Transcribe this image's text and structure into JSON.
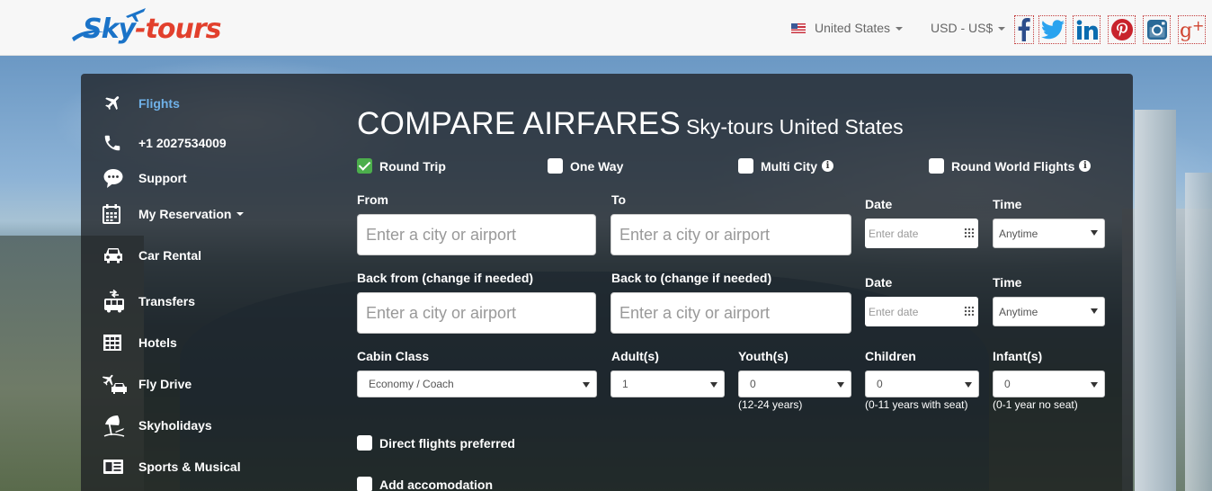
{
  "header": {
    "logo_text_sky": "Sky",
    "logo_text_tours": "-tours",
    "country": "United States",
    "currency": "USD - US$",
    "social": [
      "facebook-icon",
      "twitter-icon",
      "linkedin-icon",
      "pinterest-icon",
      "instagram-icon",
      "google-plus-icon"
    ]
  },
  "sidebar": {
    "items": [
      {
        "label": "Flights",
        "icon": "plane-icon",
        "active": true
      },
      {
        "label": "+1 2027534009",
        "icon": "phone-icon"
      },
      {
        "label": "Support",
        "icon": "chat-icon"
      },
      {
        "label": "My Reservation",
        "icon": "calendar-icon",
        "dropdown": true
      },
      {
        "label": "Car Rental",
        "icon": "car-icon"
      },
      {
        "label": "Transfers",
        "icon": "bus-icon"
      },
      {
        "label": "Hotels",
        "icon": "hotel-icon"
      },
      {
        "label": "Fly Drive",
        "icon": "fly-drive-icon"
      },
      {
        "label": "Skyholidays",
        "icon": "beach-umbrella-icon"
      },
      {
        "label": "Sports & Musical",
        "icon": "ticket-icon"
      }
    ]
  },
  "form": {
    "title": "COMPARE AIRFARES",
    "subtitle": "Sky-tours United States",
    "trip_types": [
      {
        "label": "Round Trip",
        "checked": true
      },
      {
        "label": "One Way",
        "checked": false
      },
      {
        "label": "Multi City",
        "checked": false,
        "info": true
      },
      {
        "label": "Round World Flights",
        "checked": false,
        "info": true
      }
    ],
    "outbound": {
      "from_label": "From",
      "to_label": "To",
      "date_label": "Date",
      "time_label": "Time",
      "from_placeholder": "Enter a city or airport",
      "to_placeholder": "Enter a city or airport",
      "date_placeholder": "Enter date",
      "time_value": "Anytime"
    },
    "return": {
      "from_label": "Back from (change if needed)",
      "to_label": "Back to (change if needed)",
      "date_label": "Date",
      "time_label": "Time",
      "from_placeholder": "Enter a city or airport",
      "to_placeholder": "Enter a city or airport",
      "date_placeholder": "Enter date",
      "time_value": "Anytime"
    },
    "passengers": {
      "cabin_label": "Cabin Class",
      "cabin_value": "Economy / Coach",
      "adults_label": "Adult(s)",
      "adults_value": "1",
      "youth_label": "Youth(s)",
      "youth_value": "0",
      "youth_hint": "(12-24 years)",
      "children_label": "Children",
      "children_value": "0",
      "children_hint": "(0-11 years with seat)",
      "infants_label": "Infant(s)",
      "infants_value": "0",
      "infants_hint": "(0-1 year no seat)"
    },
    "options": {
      "direct_label": "Direct flights preferred",
      "accomodation_label": "Add accomodation"
    }
  },
  "colors": {
    "accent": "#6fb1e8",
    "check_green": "#4cae4c",
    "logo_blue": "#1a73c8",
    "logo_red": "#e2402d"
  }
}
